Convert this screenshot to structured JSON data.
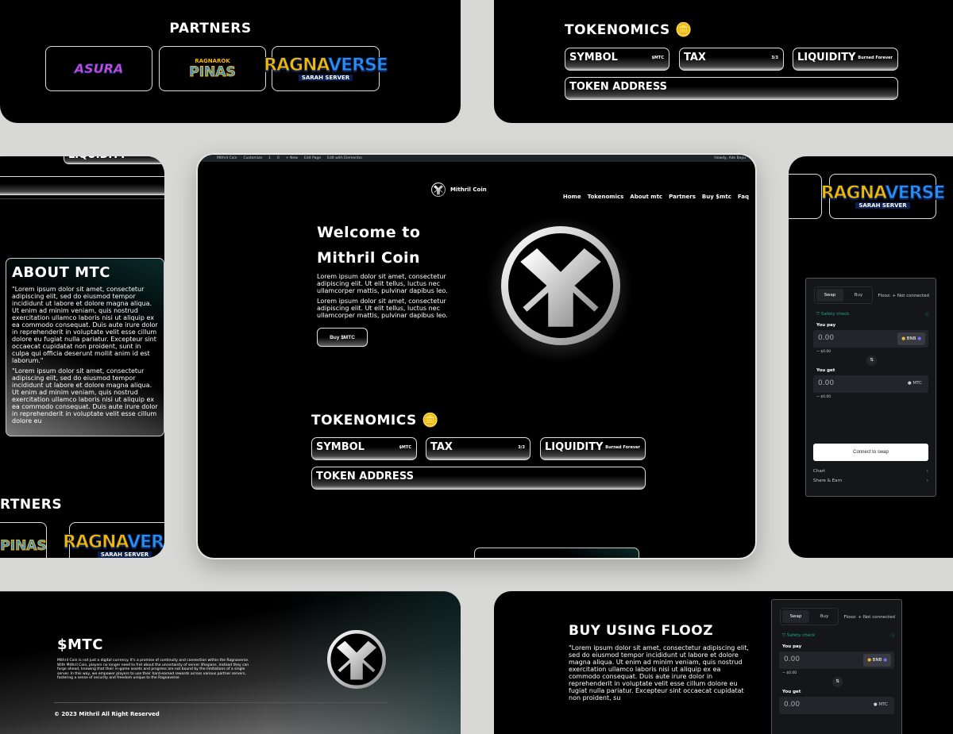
{
  "partners": {
    "title": "PARTNERS",
    "title_partial": "RTNERS",
    "logos": [
      "Asura Games",
      "Ragnarok Pinas",
      "RAGNAVERSE"
    ],
    "ragnaverse": {
      "a": "RAGNA",
      "b": "VERSE",
      "sub": "SARAH SERVER"
    },
    "asura": "ASURA",
    "pinas": {
      "a": "RAGNAROK",
      "b": "PINAS"
    }
  },
  "tokenomics": {
    "title": "TOKENOMICS",
    "items": [
      {
        "label": "SYMBOL",
        "value": "$MTC"
      },
      {
        "label": "TAX",
        "value": "3/3"
      },
      {
        "label": "LIQUIDITY",
        "value": "Burned Forever"
      }
    ],
    "address_label": "TOKEN ADDRESS"
  },
  "about": {
    "title": "ABOUT MTC",
    "p1": "\"Lorem ipsum dolor sit amet, consectetur adipiscing elit, sed do eiusmod tempor incididunt ut labore et dolore magna aliqua. Ut enim ad minim veniam, quis nostrud exercitation ullamco laboris nisi ut aliquip ex ea commodo consequat. Duis aute irure dolor in reprehenderit in voluptate velit esse cillum dolore eu fugiat nulla pariatur. Excepteur sint occaecat cupidatat non proident, sunt in culpa qui officia deserunt mollit anim id est laborum.\"",
    "p2": "\"Lorem ipsum dolor sit amet, consectetur adipiscing elit, sed do eiusmod tempor incididunt ut labore et dolore magna aliqua. Ut enim ad minim veniam, quis nostrud exercitation ullamco laboris nisi ut aliquip ex ea commodo consequat. Duis aute irure dolor in reprehenderit in voluptate velit esse cillum dolore eu"
  },
  "adminbar": {
    "items": [
      "Mithril Coin",
      "Customize",
      "1",
      "0",
      "+ New",
      "Edit Page",
      "Edit with Elementor"
    ],
    "howdy": "Howdy, Ade Bayu"
  },
  "site": {
    "brand": "Mithril Coin",
    "nav": [
      "Home",
      "Tokenomics",
      "About mtc",
      "Partners",
      "Buy $mtc",
      "Faq"
    ]
  },
  "hero": {
    "line1": "Welcome to",
    "line2": "Mithril Coin",
    "p1": "Lorem ipsum dolor sit amet, consectetur adipiscing elit. Ut elit tellus, luctus nec ullamcorper mattis, pulvinar dapibus leo.",
    "p2": "Lorem ipsum dolor sit amet, consectetur adipiscing elit. Ut elit tellus, luctus nec ullamcorper mattis, pulvinar dapibus leo.",
    "cta": "Buy $MTC"
  },
  "swap": {
    "tab_swap": "Swap",
    "tab_buy": "Buy",
    "status": "Flooz: + Not connected",
    "safety": "Safety check",
    "you_pay": "You pay",
    "pay_value": "0.00",
    "pay_token": "BNB",
    "pay_usd": "~ $0.00",
    "you_get": "You get",
    "get_value": "0.00",
    "get_token": "MTC",
    "get_usd": "~ $0.00",
    "connect": "Connect to swap",
    "chart": "Chart",
    "share": "Share & Earn"
  },
  "footer": {
    "title": "$MTC",
    "text": "Mithril Coin is not just a digital currency. It's a promise of continuity and connection within the Ragnaverse. With Mithril Coin, players no longer need to fret about the uncertainty of server lifespans. Instead they can forge ahead, knowing that their in-game assets and progress are not bound by the limitations of a single server. In this way, we empower players to use their hard-earned rewards across various partner servers, fostering a sense of security and freedom unique to the Ragnaverse",
    "copyright": "© 2023 Mithril All Right Reserved"
  },
  "flooz": {
    "title": "BUY USING FLOOZ",
    "text": "\"Lorem ipsum dolor sit amet, consectetur adipiscing elit, sed do eiusmod tempor incididunt ut labore et dolore magna aliqua. Ut enim ad minim veniam, quis nostrud exercitation ullamco laboris nisi ut aliquip ex ea commodo consequat. Duis aute irure dolor in reprehenderit in voluptate velit esse cillum dolore eu fugiat nulla pariatur. Excepteur sint occaecat cupidatat non proident, su"
  }
}
